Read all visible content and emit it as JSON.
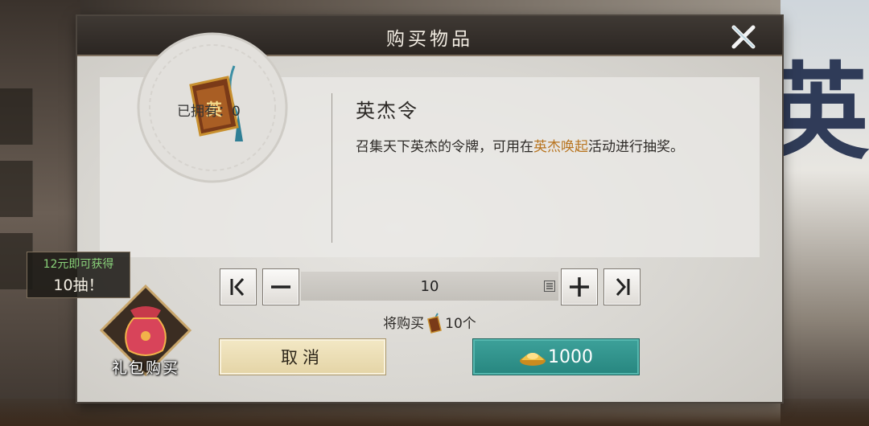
{
  "dialog": {
    "title": "购买物品"
  },
  "item": {
    "owned_label": "已拥有：",
    "owned_count": "0",
    "name": "英杰令",
    "desc_part1": "召集天下英杰的令牌，可用在",
    "desc_highlight": "英杰唤起",
    "desc_part2": "活动进行抽奖。",
    "emblem_char": "英",
    "highlight_color": "#b8741f"
  },
  "quantity": {
    "value": "10"
  },
  "summary": {
    "prefix": "将购买",
    "suffix": "10个"
  },
  "buttons": {
    "cancel": "取消",
    "buy_price": "1000"
  },
  "promo": {
    "line1": "12元即可获得",
    "line2": "10抽！",
    "gift_label": "礼包购买"
  },
  "background": {
    "banner_char": "英"
  },
  "icons": [
    "close-icon",
    "jump-to-min-icon",
    "minus-icon",
    "plus-icon",
    "jump-to-max-icon",
    "keypad-icon",
    "gold-ingot-icon",
    "gift-bag-icon",
    "token-icon"
  ]
}
